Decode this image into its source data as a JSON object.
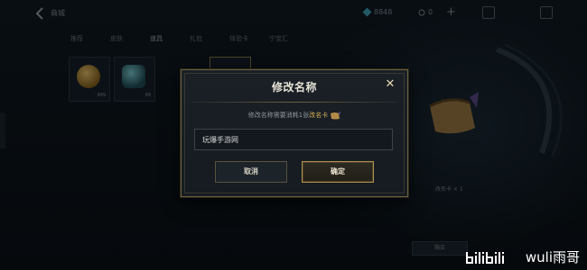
{
  "background": {
    "back_label": "商城",
    "currency_amount": "8848",
    "coin_count": "0",
    "tabs": [
      "推荐",
      "皮肤",
      "道具",
      "礼包",
      "体验卡",
      "宁宝汇"
    ],
    "active_tab_index": 2,
    "items": [
      {
        "qty": "999",
        "color": "#c99a3c"
      },
      {
        "qty": "99",
        "color": "#3b7f8c"
      }
    ],
    "preview_label": "改名卡 × 1",
    "bottom_button": "购买"
  },
  "modal": {
    "title": "修改名称",
    "cost_prefix": "修改名称需要消耗1张",
    "cost_item": "改名卡",
    "input_value": "玩爆手游网",
    "cancel_label": "取消",
    "confirm_label": "确定"
  },
  "watermark": {
    "text": "wuli雨哥"
  },
  "colors": {
    "accent_gold": "#b2914c",
    "highlight": "#d9b15a"
  }
}
